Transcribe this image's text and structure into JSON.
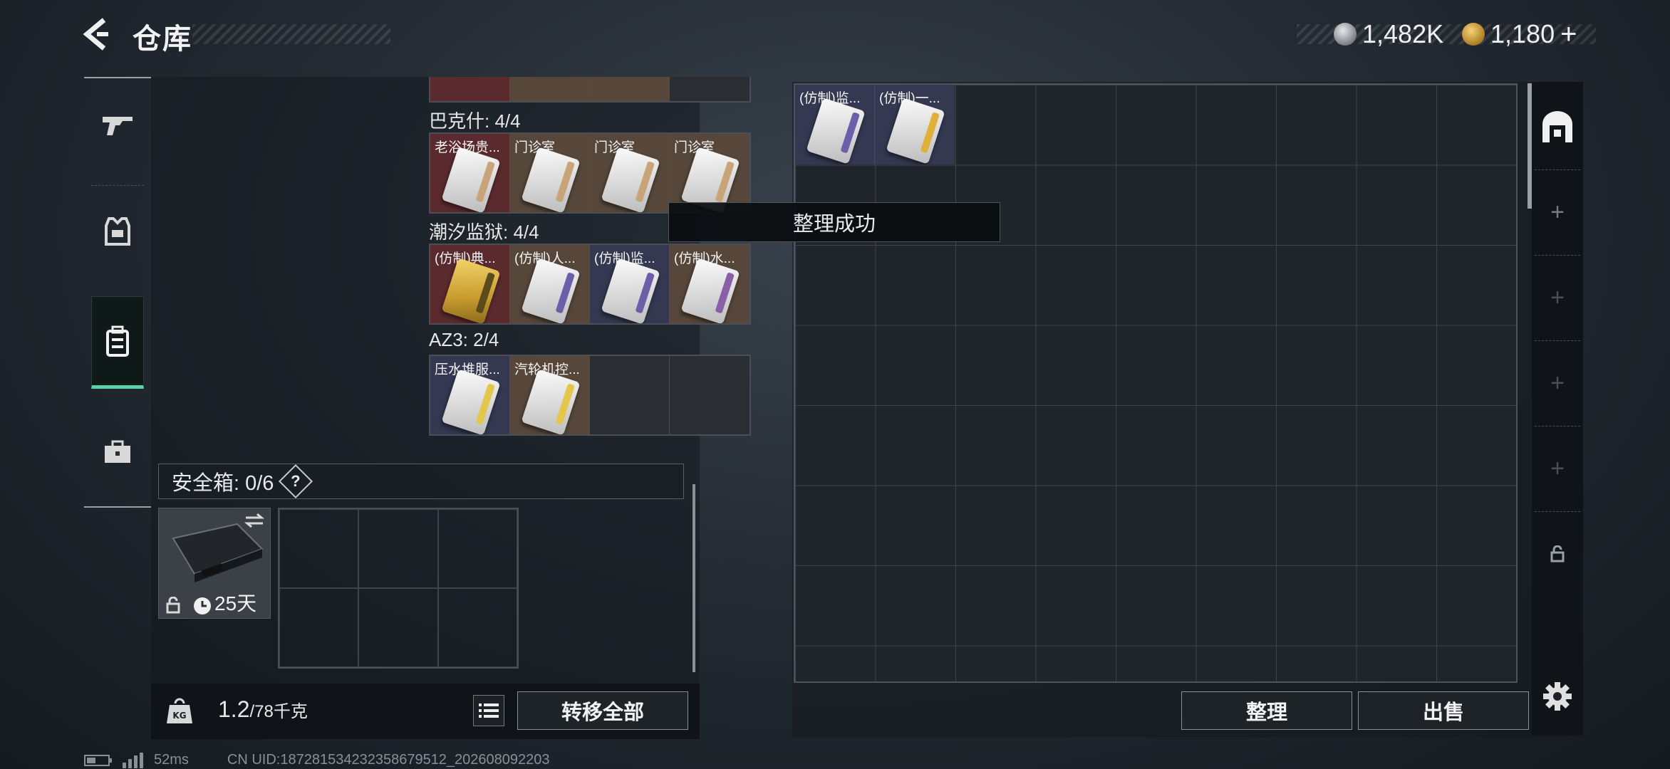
{
  "header": {
    "title": "仓库"
  },
  "currency": {
    "silver": "1,482K",
    "gold": "1,180",
    "gold_add": "+"
  },
  "left_nav": [
    {
      "icon": "gun-icon"
    },
    {
      "icon": "armor-vest-icon"
    },
    {
      "icon": "backpack-icon",
      "active": true
    },
    {
      "icon": "briefcase-icon"
    }
  ],
  "sections": [
    {
      "title": "巴克什: 4/4",
      "items": [
        {
          "label": "老浴场贵...",
          "bg": "red",
          "stripe": "#c9a37a"
        },
        {
          "label": "门诊室",
          "bg": "brown",
          "stripe": "#c9a37a"
        },
        {
          "label": "门诊室",
          "bg": "brown",
          "stripe": "#c9a37a"
        },
        {
          "label": "门诊室",
          "bg": "brown",
          "stripe": "#c9a37a"
        }
      ]
    },
    {
      "title": "潮汐监狱: 4/4",
      "items": [
        {
          "label": "(仿制)典...",
          "bg": "red",
          "stripe": "#e0b13a",
          "gold": true
        },
        {
          "label": "(仿制)人...",
          "bg": "brown",
          "stripe": "#6b5fa8"
        },
        {
          "label": "(仿制)监...",
          "bg": "navy",
          "stripe": "#6b5fa8"
        },
        {
          "label": "(仿制)水...",
          "bg": "brown",
          "stripe": "#8a5fa8"
        }
      ]
    },
    {
      "title": "AZ3: 2/4",
      "items": [
        {
          "label": "压水堆服...",
          "bg": "navy",
          "stripe": "#e3c64a"
        },
        {
          "label": "汽轮机控...",
          "bg": "brown",
          "stripe": "#e3c64a"
        },
        {
          "label": "",
          "bg": "dark",
          "stripe": ""
        },
        {
          "label": "",
          "bg": "dark",
          "stripe": ""
        }
      ]
    }
  ],
  "safebox": {
    "label": "安全箱: 0/6",
    "help": "?",
    "timer": "25天"
  },
  "bottom_left": {
    "weight_value": "1.2",
    "weight_capacity": "/78千克",
    "transfer_all": "转移全部"
  },
  "storage_items": [
    {
      "label": "(仿制)监...",
      "stripe": "#6b5fa8"
    },
    {
      "label": "(仿制)一...",
      "stripe": "#e0b13a"
    }
  ],
  "toast": "整理成功",
  "actions": {
    "organize": "整理",
    "sell": "出售"
  },
  "status_bar": {
    "ping": "52ms",
    "uid": "CN UID:18728153423235867951​2_202608092203"
  }
}
